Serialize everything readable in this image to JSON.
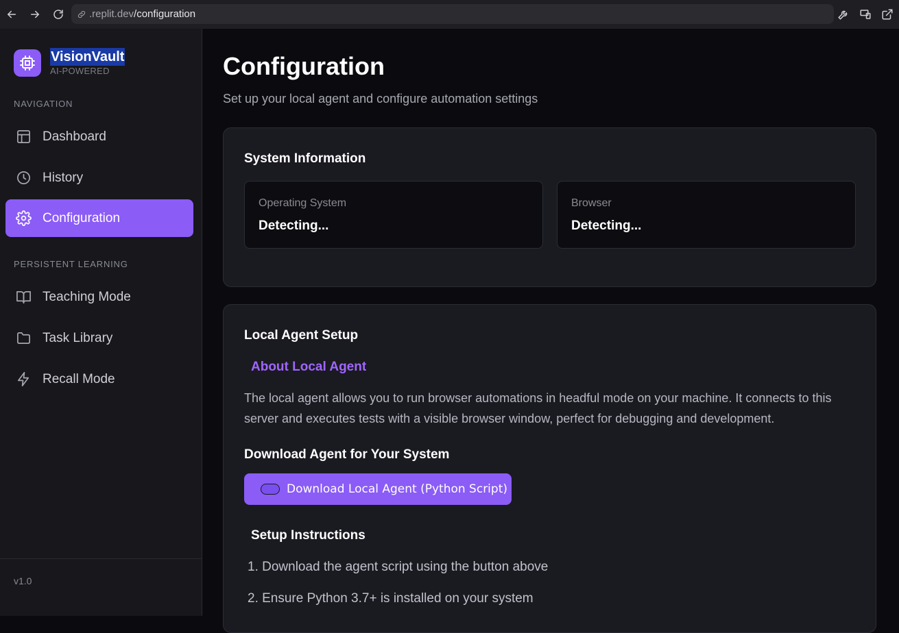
{
  "browser": {
    "url_host": ".replit.dev",
    "url_path": "/configuration"
  },
  "sidebar": {
    "brand_name": "VisionVault",
    "brand_sub": "AI-POWERED",
    "nav_label": "NAVIGATION",
    "nav_items": [
      {
        "label": "Dashboard",
        "icon": "layout-icon"
      },
      {
        "label": "History",
        "icon": "clock-icon"
      },
      {
        "label": "Configuration",
        "icon": "gear-icon",
        "active": true
      }
    ],
    "learning_label": "PERSISTENT LEARNING",
    "learning_items": [
      {
        "label": "Teaching Mode",
        "icon": "book-icon"
      },
      {
        "label": "Task Library",
        "icon": "folder-icon"
      },
      {
        "label": "Recall Mode",
        "icon": "bolt-icon"
      }
    ],
    "version": "v1.0"
  },
  "main": {
    "title": "Configuration",
    "subtitle": "Set up your local agent and configure automation settings",
    "system_info": {
      "title": "System Information",
      "os_label": "Operating System",
      "os_value": "Detecting...",
      "browser_label": "Browser",
      "browser_value": "Detecting..."
    },
    "agent": {
      "title": "Local Agent Setup",
      "about_title": "About Local Agent",
      "about_text": "The local agent allows you to run browser automations in headful mode on your machine. It connects to this server and executes tests with a visible browser window, perfect for debugging and development.",
      "download_title": "Download Agent for Your System",
      "download_button": "Download Local Agent (Python Script)",
      "setup_title": "Setup Instructions",
      "steps": [
        "1. Download the agent script using the button above",
        "2. Ensure Python 3.7+ is installed on your system"
      ]
    }
  },
  "colors": {
    "accent": "#8b5cf6",
    "accent_text": "#a066ff",
    "background": "#0b0b0f",
    "sidebar": "#17171c",
    "card": "#1a1a21"
  }
}
